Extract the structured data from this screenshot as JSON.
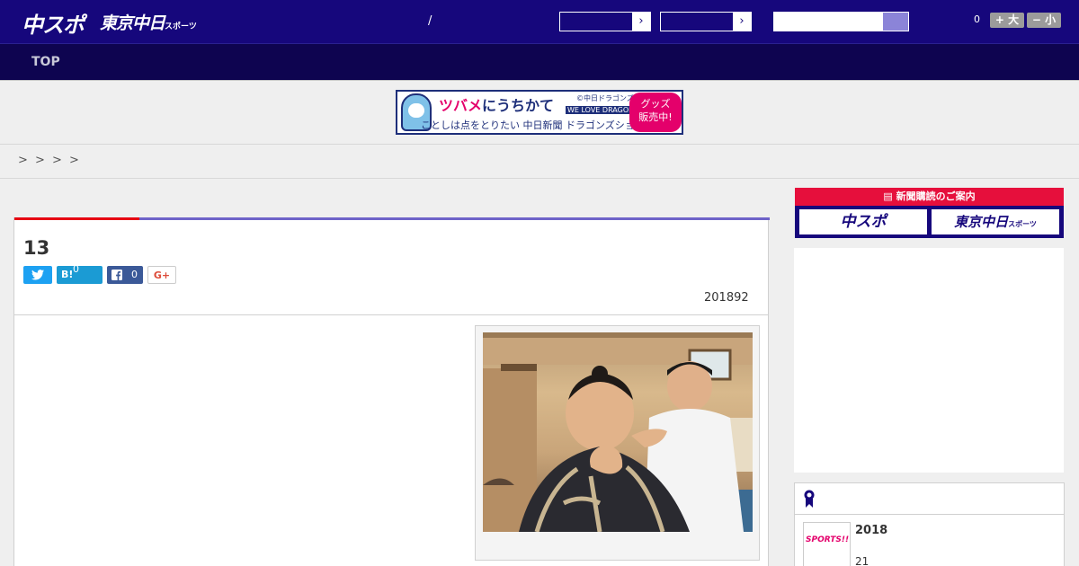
{
  "header": {
    "logo_chuspo": "中スポ",
    "logo_tokyo": "東京中日",
    "logo_tokyo_small": "スポーツ",
    "slash": "/",
    "select1_arrow": "›",
    "select2_arrow": "›",
    "count": "0",
    "font_bigger": "+ 大",
    "font_smaller": "− 小"
  },
  "nav": {
    "top": "TOP"
  },
  "banner": {
    "line1_a": "ツバメ",
    "line1_b": "にうちかて",
    "line2": "ことしは点をとりたい 中日新聞 ドラゴンズショップ",
    "brand": "©中日ドラゴンズ",
    "tagline": "WE LOVE DRAGONS",
    "badge_line1": "グッズ",
    "badge_line2": "販売中!"
  },
  "breadcrumb": [
    ">",
    ">",
    ">",
    ">"
  ],
  "article": {
    "title": "13",
    "share": {
      "twitter_icon": "t",
      "hatena_label": "B!",
      "hatena_count": "0",
      "facebook_icon": "f",
      "facebook_count": "0",
      "gplus_label": "G+"
    },
    "date": "201892"
  },
  "sidebar": {
    "subscribe_header": "新聞購読のご案内",
    "subscribe_chuspo": "中スポ",
    "subscribe_tokyo": "東京中日",
    "subscribe_tokyo_small": "スポーツ",
    "ranking": {
      "thumb_text": "SPORTS!!",
      "item_title": "2018",
      "item_sub": "21"
    }
  },
  "colors": {
    "header_bg": "#16077c",
    "nav_bg": "#0e0450",
    "accent_red": "#e60012",
    "accent_purple": "#6e62c8"
  }
}
